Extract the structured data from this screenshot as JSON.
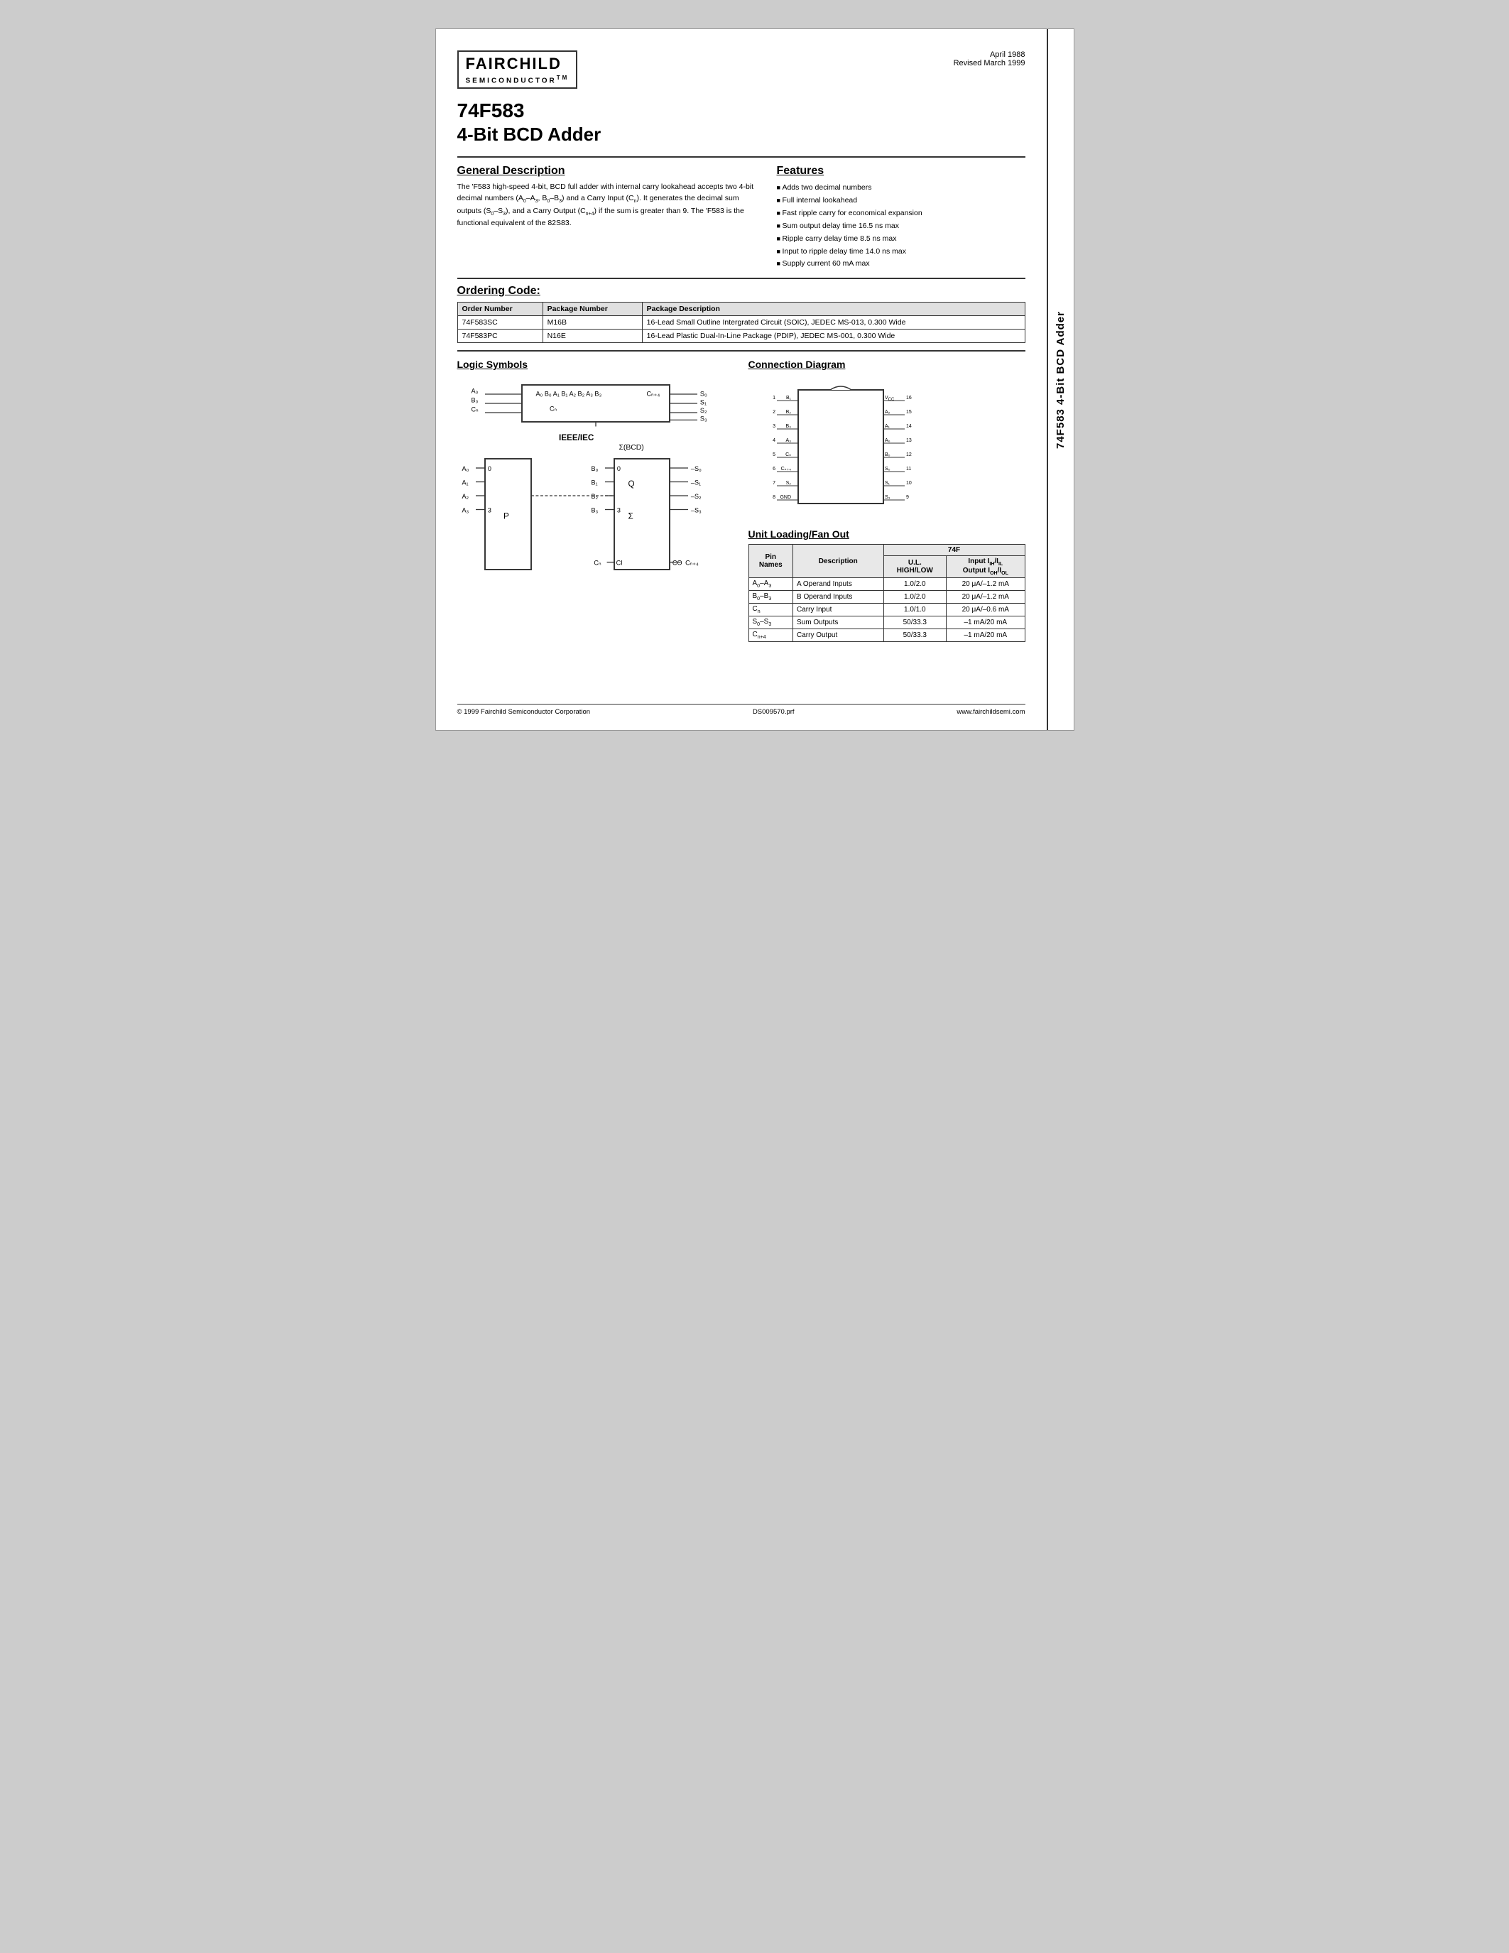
{
  "side_tab": {
    "text": "74F583 4-Bit BCD Adder"
  },
  "header": {
    "company": "FAIRCHILD",
    "semiconductor": "SEMICONDUCTOR",
    "tm": "TM",
    "date1": "April 1988",
    "date2": "Revised March 1999"
  },
  "title": {
    "line1": "74F583",
    "line2": "4-Bit BCD Adder"
  },
  "general_description": {
    "heading": "General Description",
    "text": "The 'F583 high-speed 4-bit, BCD full adder with internal carry lookahead accepts two 4-bit decimal numbers (A₀–A₃, B₀–B₃) and a Carry Input (Cₙ). It generates the decimal sum outputs (S₀–S₃), and a Carry Output (Cₙ₊₄) if the sum is greater than 9. The 'F583 is the functional equivalent of the 82S83."
  },
  "features": {
    "heading": "Features",
    "items": [
      "Adds two decimal numbers",
      "Full internal lookahead",
      "Fast ripple carry for economical expansion",
      "Sum output delay time 16.5 ns max",
      "Ripple carry delay time 8.5 ns max",
      "Input to ripple delay time 14.0 ns max",
      "Supply current 60 mA max"
    ]
  },
  "ordering": {
    "heading": "Ordering Code:",
    "columns": [
      "Order Number",
      "Package Number",
      "Package Description"
    ],
    "rows": [
      {
        "order": "74F583SC",
        "package": "M16B",
        "description": "16-Lead Small Outline Intergrated Circuit (SOIC), JEDEC MS-013, 0.300 Wide"
      },
      {
        "order": "74F583PC",
        "package": "N16E",
        "description": "16-Lead Plastic Dual-In-Line Package (PDIP), JEDEC MS-001, 0.300 Wide"
      }
    ]
  },
  "logic_symbols": {
    "heading": "Logic Symbols"
  },
  "connection_diagram": {
    "heading": "Connection Diagram"
  },
  "unit_loading": {
    "heading": "Unit Loading/Fan Out",
    "col_74f": "74F",
    "cols": [
      "Pin Names",
      "Description",
      "U.L. HIGH/LOW",
      "Input IIH/IIL Output IOH/IOL"
    ],
    "rows": [
      {
        "pin": "A₀–A₃",
        "desc": "A Operand Inputs",
        "ul": "1.0/2.0",
        "io": "20 μA/–1.2 mA"
      },
      {
        "pin": "B₀–B₃",
        "desc": "B Operand Inputs",
        "ul": "1.0/2.0",
        "io": "20 μA/–1.2 mA"
      },
      {
        "pin": "Cₙ",
        "desc": "Carry Input",
        "ul": "1.0/1.0",
        "io": "20 μA/–0.6 mA"
      },
      {
        "pin": "S₀–S₃",
        "desc": "Sum Outputs",
        "ul": "50/33.3",
        "io": "–1 mA/20 mA"
      },
      {
        "pin": "Cₙ₊₄",
        "desc": "Carry Output",
        "ul": "50/33.3",
        "io": "–1 mA/20 mA"
      }
    ]
  },
  "footer": {
    "copyright": "© 1999 Fairchild Semiconductor Corporation",
    "doc": "DS009570.prf",
    "website": "www.fairchildsemi.com"
  }
}
